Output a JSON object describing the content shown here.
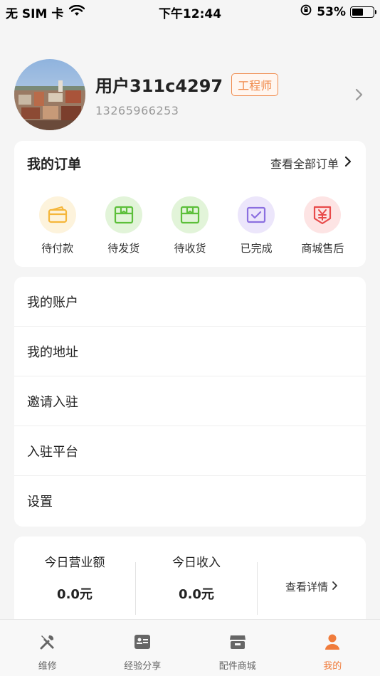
{
  "status_bar": {
    "carrier": "无 SIM 卡",
    "time": "下午12:44",
    "battery_percent": "53%",
    "battery_level": 0.53
  },
  "profile": {
    "username": "用户311c4297",
    "role_badge": "工程师",
    "phone": "13265966253"
  },
  "orders": {
    "title": "我的订单",
    "view_all": "查看全部订单",
    "items": [
      {
        "label": "待付款",
        "icon": "wallet-icon",
        "color": "#f5b63a",
        "bg": "#fdf3dc"
      },
      {
        "label": "待发货",
        "icon": "box-icon",
        "color": "#5cbf3a",
        "bg": "#e2f4d9"
      },
      {
        "label": "待收货",
        "icon": "box-icon",
        "color": "#5cbf3a",
        "bg": "#e2f4d9"
      },
      {
        "label": "已完成",
        "icon": "check-icon",
        "color": "#8b6fe0",
        "bg": "#ece6fb"
      },
      {
        "label": "商城售后",
        "icon": "yen-icon",
        "color": "#e84a4a",
        "bg": "#fde4e4"
      }
    ]
  },
  "menu": {
    "items": [
      "我的账户",
      "我的地址",
      "邀请入驻",
      "入驻平台",
      "设置"
    ]
  },
  "stats": {
    "today_sales_label": "今日营业额",
    "today_sales_value": "0.0元",
    "today_income_label": "今日收入",
    "today_income_value": "0.0元",
    "details_link": "查看详情"
  },
  "tabbar": {
    "tabs": [
      {
        "label": "维修",
        "icon": "tools-icon"
      },
      {
        "label": "经验分享",
        "icon": "card-icon"
      },
      {
        "label": "配件商城",
        "icon": "store-icon"
      },
      {
        "label": "我的",
        "icon": "person-icon"
      }
    ],
    "active_index": 3,
    "accent": "#f07c3c"
  }
}
